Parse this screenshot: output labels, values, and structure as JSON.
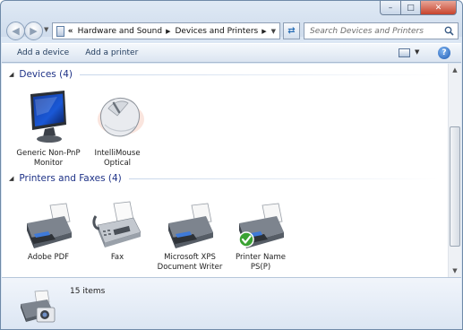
{
  "window": {
    "controls": {
      "minimize": "–",
      "maximize": "□",
      "close": "✕"
    }
  },
  "navigation": {
    "back_icon": "back-arrow-icon",
    "forward_icon": "forward-arrow-icon",
    "breadcrumb_overflow": "«",
    "breadcrumbs": [
      "Hardware and Sound",
      "Devices and Printers"
    ],
    "refresh_icon": "refresh-icon"
  },
  "search": {
    "placeholder": "Search Devices and Printers"
  },
  "toolbar": {
    "add_device": "Add a device",
    "add_printer": "Add a printer",
    "help": "?"
  },
  "groups": [
    {
      "title": "Devices (4)",
      "items": [
        {
          "label": "Generic Non-PnP\nMonitor",
          "icon": "monitor-icon"
        },
        {
          "label": "IntelliMouse\nOptical",
          "icon": "mouse-icon"
        }
      ]
    },
    {
      "title": "Printers and Faxes (4)",
      "items": [
        {
          "label": "Adobe PDF",
          "icon": "printer-icon"
        },
        {
          "label": "Fax",
          "icon": "fax-icon"
        },
        {
          "label": "Microsoft XPS\nDocument Writer",
          "icon": "printer-icon"
        },
        {
          "label": "Printer Name\nPS(P)",
          "icon": "default-printer-icon",
          "is_default": true
        }
      ]
    }
  ],
  "details": {
    "count": "15 items",
    "icon": "devices-camera-printer-icon"
  },
  "colors": {
    "group_title": "#1e3287",
    "default_check": "#3aa233"
  }
}
